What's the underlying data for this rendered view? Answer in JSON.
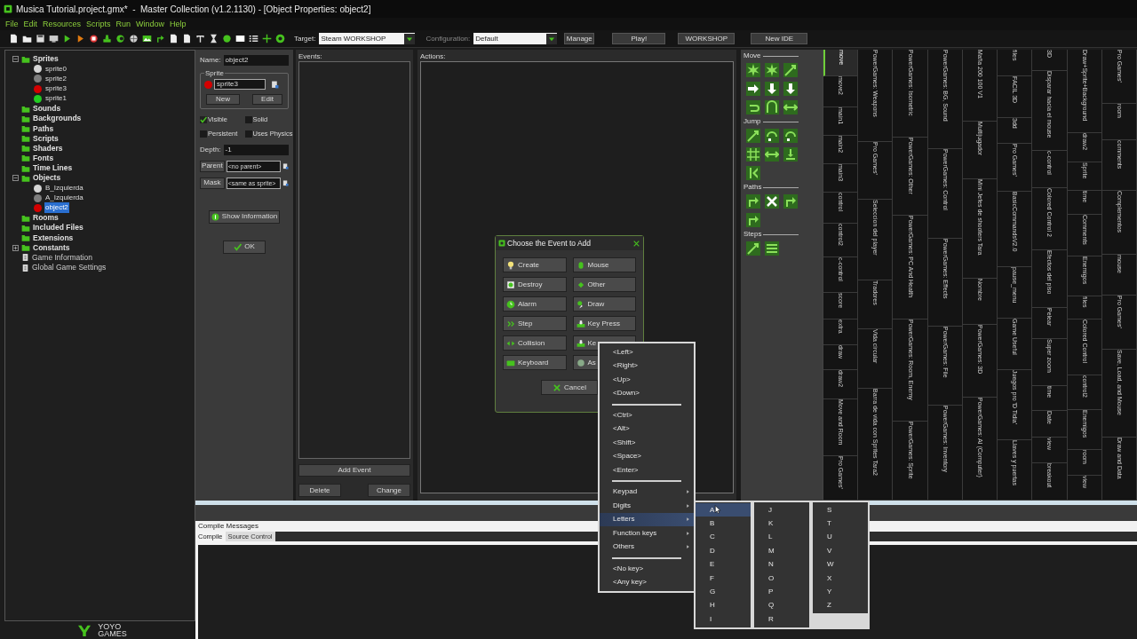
{
  "window": {
    "title": "Musica Tutorial.project.gmx*  -  Master Collection (v1.2.1130) - [Object Properties: object2]"
  },
  "menu": [
    "File",
    "Edit",
    "Resources",
    "Scripts",
    "Run",
    "Window",
    "Help"
  ],
  "toolbar": {
    "target_label": "Target:",
    "target": "Steam WORKSHOP",
    "configuration_label": "Configuration:",
    "configuration": "Default",
    "buttons": [
      "Manage",
      "Play!",
      "WORKSHOP",
      "New IDE"
    ]
  },
  "tree": [
    {
      "label": "Sprites",
      "kind": "group",
      "expanded": true,
      "children": [
        {
          "label": "sprite0",
          "color": "#d6d6d6",
          "selected": false
        },
        {
          "label": "sprite2",
          "color": "#7e7e7e",
          "selected": false
        },
        {
          "label": "sprite3",
          "color": "#d40000",
          "selected": false
        },
        {
          "label": "sprite1",
          "color": "#22cc22",
          "selected": false
        }
      ]
    },
    {
      "label": "Sounds",
      "kind": "folder"
    },
    {
      "label": "Backgrounds",
      "kind": "folder"
    },
    {
      "label": "Paths",
      "kind": "folder"
    },
    {
      "label": "Scripts",
      "kind": "folder"
    },
    {
      "label": "Shaders",
      "kind": "folder"
    },
    {
      "label": "Fonts",
      "kind": "folder"
    },
    {
      "label": "Time Lines",
      "kind": "folder"
    },
    {
      "label": "Objects",
      "kind": "group",
      "expanded": true,
      "children": [
        {
          "label": "B_Izquierda",
          "color": "#d6d6d6",
          "selected": false
        },
        {
          "label": "A_Izquierda",
          "color": "#7e7e7e",
          "selected": false
        },
        {
          "label": "object2",
          "color": "#d40000",
          "selected": true
        }
      ]
    },
    {
      "label": "Rooms",
      "kind": "folder"
    },
    {
      "label": "Included Files",
      "kind": "folder"
    },
    {
      "label": "Extensions",
      "kind": "folder"
    },
    {
      "label": "Constants",
      "kind": "group",
      "expanded": false
    },
    {
      "label": "Game Information",
      "kind": "file"
    },
    {
      "label": "Global Game Settings",
      "kind": "file"
    }
  ],
  "logo": [
    "YOYO",
    "GAMES"
  ],
  "properties": {
    "name_label": "Name:",
    "name": "object2",
    "sprite_group": "Sprite",
    "sprite": "sprite3",
    "new": "New",
    "edit": "Edit",
    "checkboxes": [
      {
        "label": "Visible",
        "checked": true
      },
      {
        "label": "Solid",
        "checked": false
      },
      {
        "label": "Persistent",
        "checked": false
      },
      {
        "label": "Uses Physics",
        "checked": false
      }
    ],
    "depth_label": "Depth:",
    "depth": "-1",
    "parent_button": "Parent",
    "parent": "<no parent>",
    "mask_button": "Mask",
    "mask": "<same as sprite>",
    "show_info": "Show Information",
    "ok": "OK"
  },
  "events": {
    "label": "Events:",
    "add": "Add Event",
    "delete": "Delete",
    "change": "Change"
  },
  "actions": {
    "label": "Actions:"
  },
  "library": [
    {
      "title": "Move",
      "actions": [
        {
          "kind": "burst"
        },
        {
          "kind": "burst"
        },
        {
          "kind": "diag"
        },
        {
          "kind": "right"
        },
        {
          "kind": "down"
        },
        {
          "kind": "down"
        },
        {
          "kind": "undo"
        },
        {
          "kind": "bounce"
        },
        {
          "kind": "wrap"
        }
      ]
    },
    {
      "title": "Jump",
      "actions": [
        {
          "kind": "diag"
        },
        {
          "kind": "jump"
        },
        {
          "kind": "jump"
        },
        {
          "kind": "grid"
        },
        {
          "kind": "wrap"
        },
        {
          "kind": "snap"
        },
        {
          "kind": "stop"
        }
      ]
    },
    {
      "title": "Paths",
      "actions": [
        {
          "kind": "path"
        },
        {
          "kind": "cross"
        },
        {
          "kind": "path"
        },
        {
          "kind": "path"
        }
      ]
    },
    {
      "title": "Steps",
      "actions": [
        {
          "kind": "diag"
        },
        {
          "kind": "list"
        }
      ]
    }
  ],
  "library_tabs": [
    [
      {
        "label": "move",
        "selected": true
      },
      {
        "label": "move2",
        "selected": false
      },
      {
        "label": "main1",
        "selected": false
      },
      {
        "label": "main2",
        "selected": false
      },
      {
        "label": "main3",
        "selected": false
      },
      {
        "label": "control",
        "selected": false
      },
      {
        "label": "control2",
        "selected": false
      },
      {
        "label": "c-control",
        "selected": false
      },
      {
        "label": "score",
        "selected": false
      },
      {
        "label": "extra",
        "selected": false
      },
      {
        "label": "draw",
        "selected": false
      },
      {
        "label": "draw2",
        "selected": false
      },
      {
        "label": "Move and Room",
        "selected": false
      },
      {
        "label": "Pro Games'",
        "selected": false
      }
    ],
    [
      {
        "label": "PowerGames: Weapons",
        "selected": false
      },
      {
        "label": "Pro Games'",
        "selected": false
      },
      {
        "label": "Seleccion del player",
        "selected": false
      },
      {
        "label": "Tradores",
        "selected": false
      },
      {
        "label": "Vida circular",
        "selected": false
      },
      {
        "label": "Barra de vida con Sprites Tara2",
        "selected": false
      }
    ],
    [
      {
        "label": "PowerGames: Isometric",
        "selected": false
      },
      {
        "label": "PowerGames: Other",
        "selected": false
      },
      {
        "label": "PowerGames: PC And Health",
        "selected": false
      },
      {
        "label": "PowerGames: Room, Enemy",
        "selected": false
      },
      {
        "label": "PowerGames: Sprite",
        "selected": false
      }
    ],
    [
      {
        "label": "PowerGames: BG, Sound",
        "selected": false
      },
      {
        "label": "PowerGames: Control",
        "selected": false
      },
      {
        "label": "PowerGames: Effects",
        "selected": false
      },
      {
        "label": "PowerGames: File",
        "selected": false
      },
      {
        "label": "PowerGames: Inventory",
        "selected": false
      }
    ],
    [
      {
        "label": "Mafia 200 100 V1",
        "selected": false
      },
      {
        "label": "Multijugador",
        "selected": false
      },
      {
        "label": "Mini Jefes de shooters Tara",
        "selected": false
      },
      {
        "label": "Nombre",
        "selected": false
      },
      {
        "label": "PowerGames: 3D",
        "selected": false
      },
      {
        "label": "PowerGames: AI (Computer)",
        "selected": false
      }
    ],
    [
      {
        "label": "files",
        "selected": false
      },
      {
        "label": "FACIL 3D",
        "selected": false
      },
      {
        "label": "3dd",
        "selected": false
      },
      {
        "label": "Pro Games'",
        "selected": false
      },
      {
        "label": "BasicCommandsV2.0",
        "selected": false
      },
      {
        "label": "pause_menu",
        "selected": false
      },
      {
        "label": "Game Useful",
        "selected": false
      },
      {
        "label": "Juegos pro 'D Tidia'",
        "selected": false
      },
      {
        "label": "Llaves y puertas",
        "selected": false
      }
    ],
    [
      {
        "label": "3D",
        "selected": false
      },
      {
        "label": "Disparar hacia el mouse",
        "selected": false
      },
      {
        "label": "c-control",
        "selected": false
      },
      {
        "label": "Colored Control 2",
        "selected": false
      },
      {
        "label": "Efectos del piso",
        "selected": false
      },
      {
        "label": "Pelear",
        "selected": false
      },
      {
        "label": "Super zoom",
        "selected": false
      },
      {
        "label": "time",
        "selected": false
      },
      {
        "label": "Date",
        "selected": false
      },
      {
        "label": "view",
        "selected": false
      },
      {
        "label": "breakout",
        "selected": false
      }
    ],
    [
      {
        "label": "Draw+Sprite+Background",
        "selected": false
      },
      {
        "label": "draw2",
        "selected": false
      },
      {
        "label": "Sprite",
        "selected": false
      },
      {
        "label": "time",
        "selected": false
      },
      {
        "label": "Comments",
        "selected": false
      },
      {
        "label": "Enemigos",
        "selected": false
      },
      {
        "label": "files",
        "selected": false
      },
      {
        "label": "Colored Control",
        "selected": false
      },
      {
        "label": "control2",
        "selected": false
      },
      {
        "label": "Enemigos",
        "selected": false
      },
      {
        "label": "room",
        "selected": false
      },
      {
        "label": "view",
        "selected": false
      }
    ],
    [
      {
        "label": "Pro Games'",
        "selected": false
      },
      {
        "label": "room",
        "selected": false
      },
      {
        "label": "comments",
        "selected": false
      },
      {
        "label": "Complementos",
        "selected": false
      },
      {
        "label": "mouse",
        "selected": false
      },
      {
        "label": "Pro Games'",
        "selected": false
      },
      {
        "label": "Save, Load, and Mouse",
        "selected": false
      },
      {
        "label": "Draw and Data",
        "selected": false
      }
    ]
  ],
  "compile": {
    "title": "Compile Messages",
    "tabs": [
      {
        "label": "Compile",
        "selected": true
      },
      {
        "label": "Source Control",
        "selected": false
      }
    ]
  },
  "dialog": {
    "title": "Choose the Event to Add",
    "buttons": [
      {
        "label": "Create",
        "kind": "bulb"
      },
      {
        "label": "Mouse",
        "kind": "mouse"
      },
      {
        "label": "Destroy",
        "kind": "bin"
      },
      {
        "label": "Other",
        "kind": "diamond"
      },
      {
        "label": "Alarm",
        "kind": "clock"
      },
      {
        "label": "Draw",
        "kind": "brush"
      },
      {
        "label": "Step",
        "kind": "step"
      },
      {
        "label": "Key Press",
        "kind": "key"
      },
      {
        "label": "Collision",
        "kind": "arrows"
      },
      {
        "label": "Ke",
        "kind": "key"
      },
      {
        "label": "Keyboard",
        "kind": "keyboard"
      },
      {
        "label": "As",
        "kind": "globe"
      }
    ],
    "cancel": "Cancel"
  },
  "key_menu": [
    {
      "kind": "item",
      "label": "<Left>"
    },
    {
      "kind": "item",
      "label": "<Right>"
    },
    {
      "kind": "item",
      "label": "<Up>"
    },
    {
      "kind": "item",
      "label": "<Down>"
    },
    {
      "kind": "separator"
    },
    {
      "kind": "item",
      "label": "<Ctrl>"
    },
    {
      "kind": "item",
      "label": "<Alt>"
    },
    {
      "kind": "item",
      "label": "<Shift>"
    },
    {
      "kind": "item",
      "label": "<Space>"
    },
    {
      "kind": "item",
      "label": "<Enter>"
    },
    {
      "kind": "separator"
    },
    {
      "kind": "submenu",
      "label": "Keypad",
      "selected": false
    },
    {
      "kind": "submenu",
      "label": "Digits",
      "selected": false
    },
    {
      "kind": "submenu",
      "label": "Letters",
      "selected": true
    },
    {
      "kind": "submenu",
      "label": "Function keys",
      "selected": false
    },
    {
      "kind": "submenu",
      "label": "Others",
      "selected": false
    },
    {
      "kind": "separator"
    },
    {
      "kind": "item",
      "label": "<No key>"
    },
    {
      "kind": "item",
      "label": "<Any key>"
    }
  ],
  "letters_menu": [
    [
      {
        "label": "A",
        "selected": true
      },
      {
        "label": "B",
        "selected": false
      },
      {
        "label": "C",
        "selected": false
      },
      {
        "label": "D",
        "selected": false
      },
      {
        "label": "E",
        "selected": false
      },
      {
        "label": "F",
        "selected": false
      },
      {
        "label": "G",
        "selected": false
      },
      {
        "label": "H",
        "selected": false
      },
      {
        "label": "I",
        "selected": false
      }
    ],
    [
      {
        "label": "J",
        "selected": false
      },
      {
        "label": "K",
        "selected": false
      },
      {
        "label": "L",
        "selected": false
      },
      {
        "label": "M",
        "selected": false
      },
      {
        "label": "N",
        "selected": false
      },
      {
        "label": "O",
        "selected": false
      },
      {
        "label": "P",
        "selected": false
      },
      {
        "label": "Q",
        "selected": false
      },
      {
        "label": "R",
        "selected": false
      }
    ],
    [
      {
        "label": "S",
        "selected": false
      },
      {
        "label": "T",
        "selected": false
      },
      {
        "label": "U",
        "selected": false
      },
      {
        "label": "V",
        "selected": false
      },
      {
        "label": "W",
        "selected": false
      },
      {
        "label": "X",
        "selected": false
      },
      {
        "label": "Y",
        "selected": false
      },
      {
        "label": "Z",
        "selected": false
      }
    ]
  ]
}
